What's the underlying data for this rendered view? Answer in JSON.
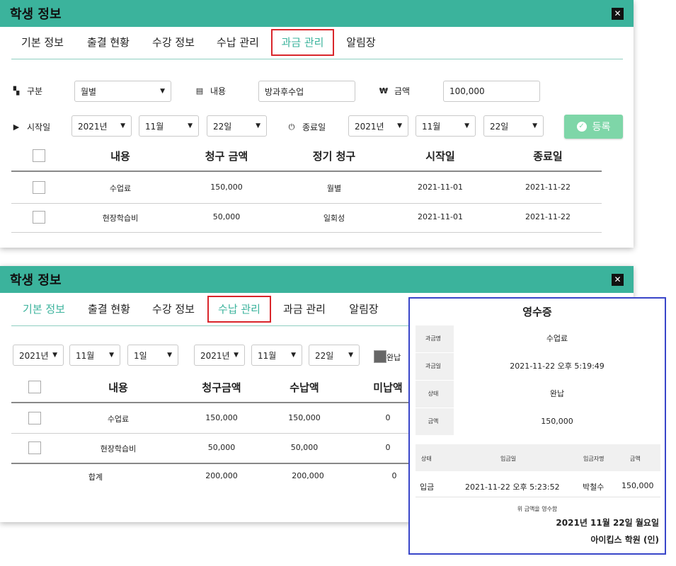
{
  "colors": {
    "accent": "#3bb39c",
    "highlight": "#d9262b",
    "register_btn": "#7ed6a8",
    "receipt_border": "#3946c9"
  },
  "panel1": {
    "title": "학생 정보",
    "tabs": [
      "기본 정보",
      "출결 현황",
      "수강 정보",
      "수납 관리",
      "과금 관리",
      "알림장"
    ],
    "active_tab": "과금 관리",
    "form": {
      "type_label": "구분",
      "type_value": "월별",
      "content_label": "내용",
      "content_value": "방과후수업",
      "amount_label": "금액",
      "amount_value": "100,000",
      "start_label": "시작일",
      "start_year": "2021년",
      "start_month": "11월",
      "start_day": "22일",
      "end_label": "종료일",
      "end_year": "2021년",
      "end_month": "11월",
      "end_day": "22일",
      "register_label": "등록"
    },
    "table": {
      "headers": [
        "내용",
        "청구 금액",
        "정기 청구",
        "시작일",
        "종료일"
      ],
      "rows": [
        [
          "수업료",
          "150,000",
          "월별",
          "2021-11-01",
          "2021-11-22"
        ],
        [
          "현장학습비",
          "50,000",
          "일회성",
          "2021-11-01",
          "2021-11-22"
        ]
      ]
    }
  },
  "panel2": {
    "title": "학생 정보",
    "tabs": [
      "기본 정보",
      "출결 현황",
      "수강 정보",
      "수납 관리",
      "과금 관리",
      "알림장"
    ],
    "active_tab": "수납 관리",
    "filters": {
      "from_year": "2021년",
      "from_month": "11월",
      "from_day": "1일",
      "to_year": "2021년",
      "to_month": "11월",
      "to_day": "22일",
      "paid_label": "완납"
    },
    "table": {
      "headers": [
        "내용",
        "청구금액",
        "수납액",
        "미납액"
      ],
      "rows": [
        [
          "수업료",
          "150,000",
          "150,000",
          "0"
        ],
        [
          "현장학습비",
          "50,000",
          "50,000",
          "0"
        ]
      ],
      "total": [
        "합계",
        "200,000",
        "200,000",
        "0"
      ]
    }
  },
  "receipt": {
    "title": "영수증",
    "fields": [
      {
        "key": "과금명",
        "value": "수업료"
      },
      {
        "key": "과금일",
        "value": "2021-11-22 오후 5:19:49"
      },
      {
        "key": "상태",
        "value": "완납"
      },
      {
        "key": "금액",
        "value": "150,000"
      }
    ],
    "pay_headers": [
      "상태",
      "입금일",
      "입금자명",
      "금액"
    ],
    "pay_row": [
      "입금",
      "2021-11-22 오후 5:23:52",
      "박철수",
      "150,000"
    ],
    "note": "위 금액을 영수함",
    "date": "2021년 11월 22일 월요일",
    "issuer": "아이킵스 학원 (인)"
  }
}
